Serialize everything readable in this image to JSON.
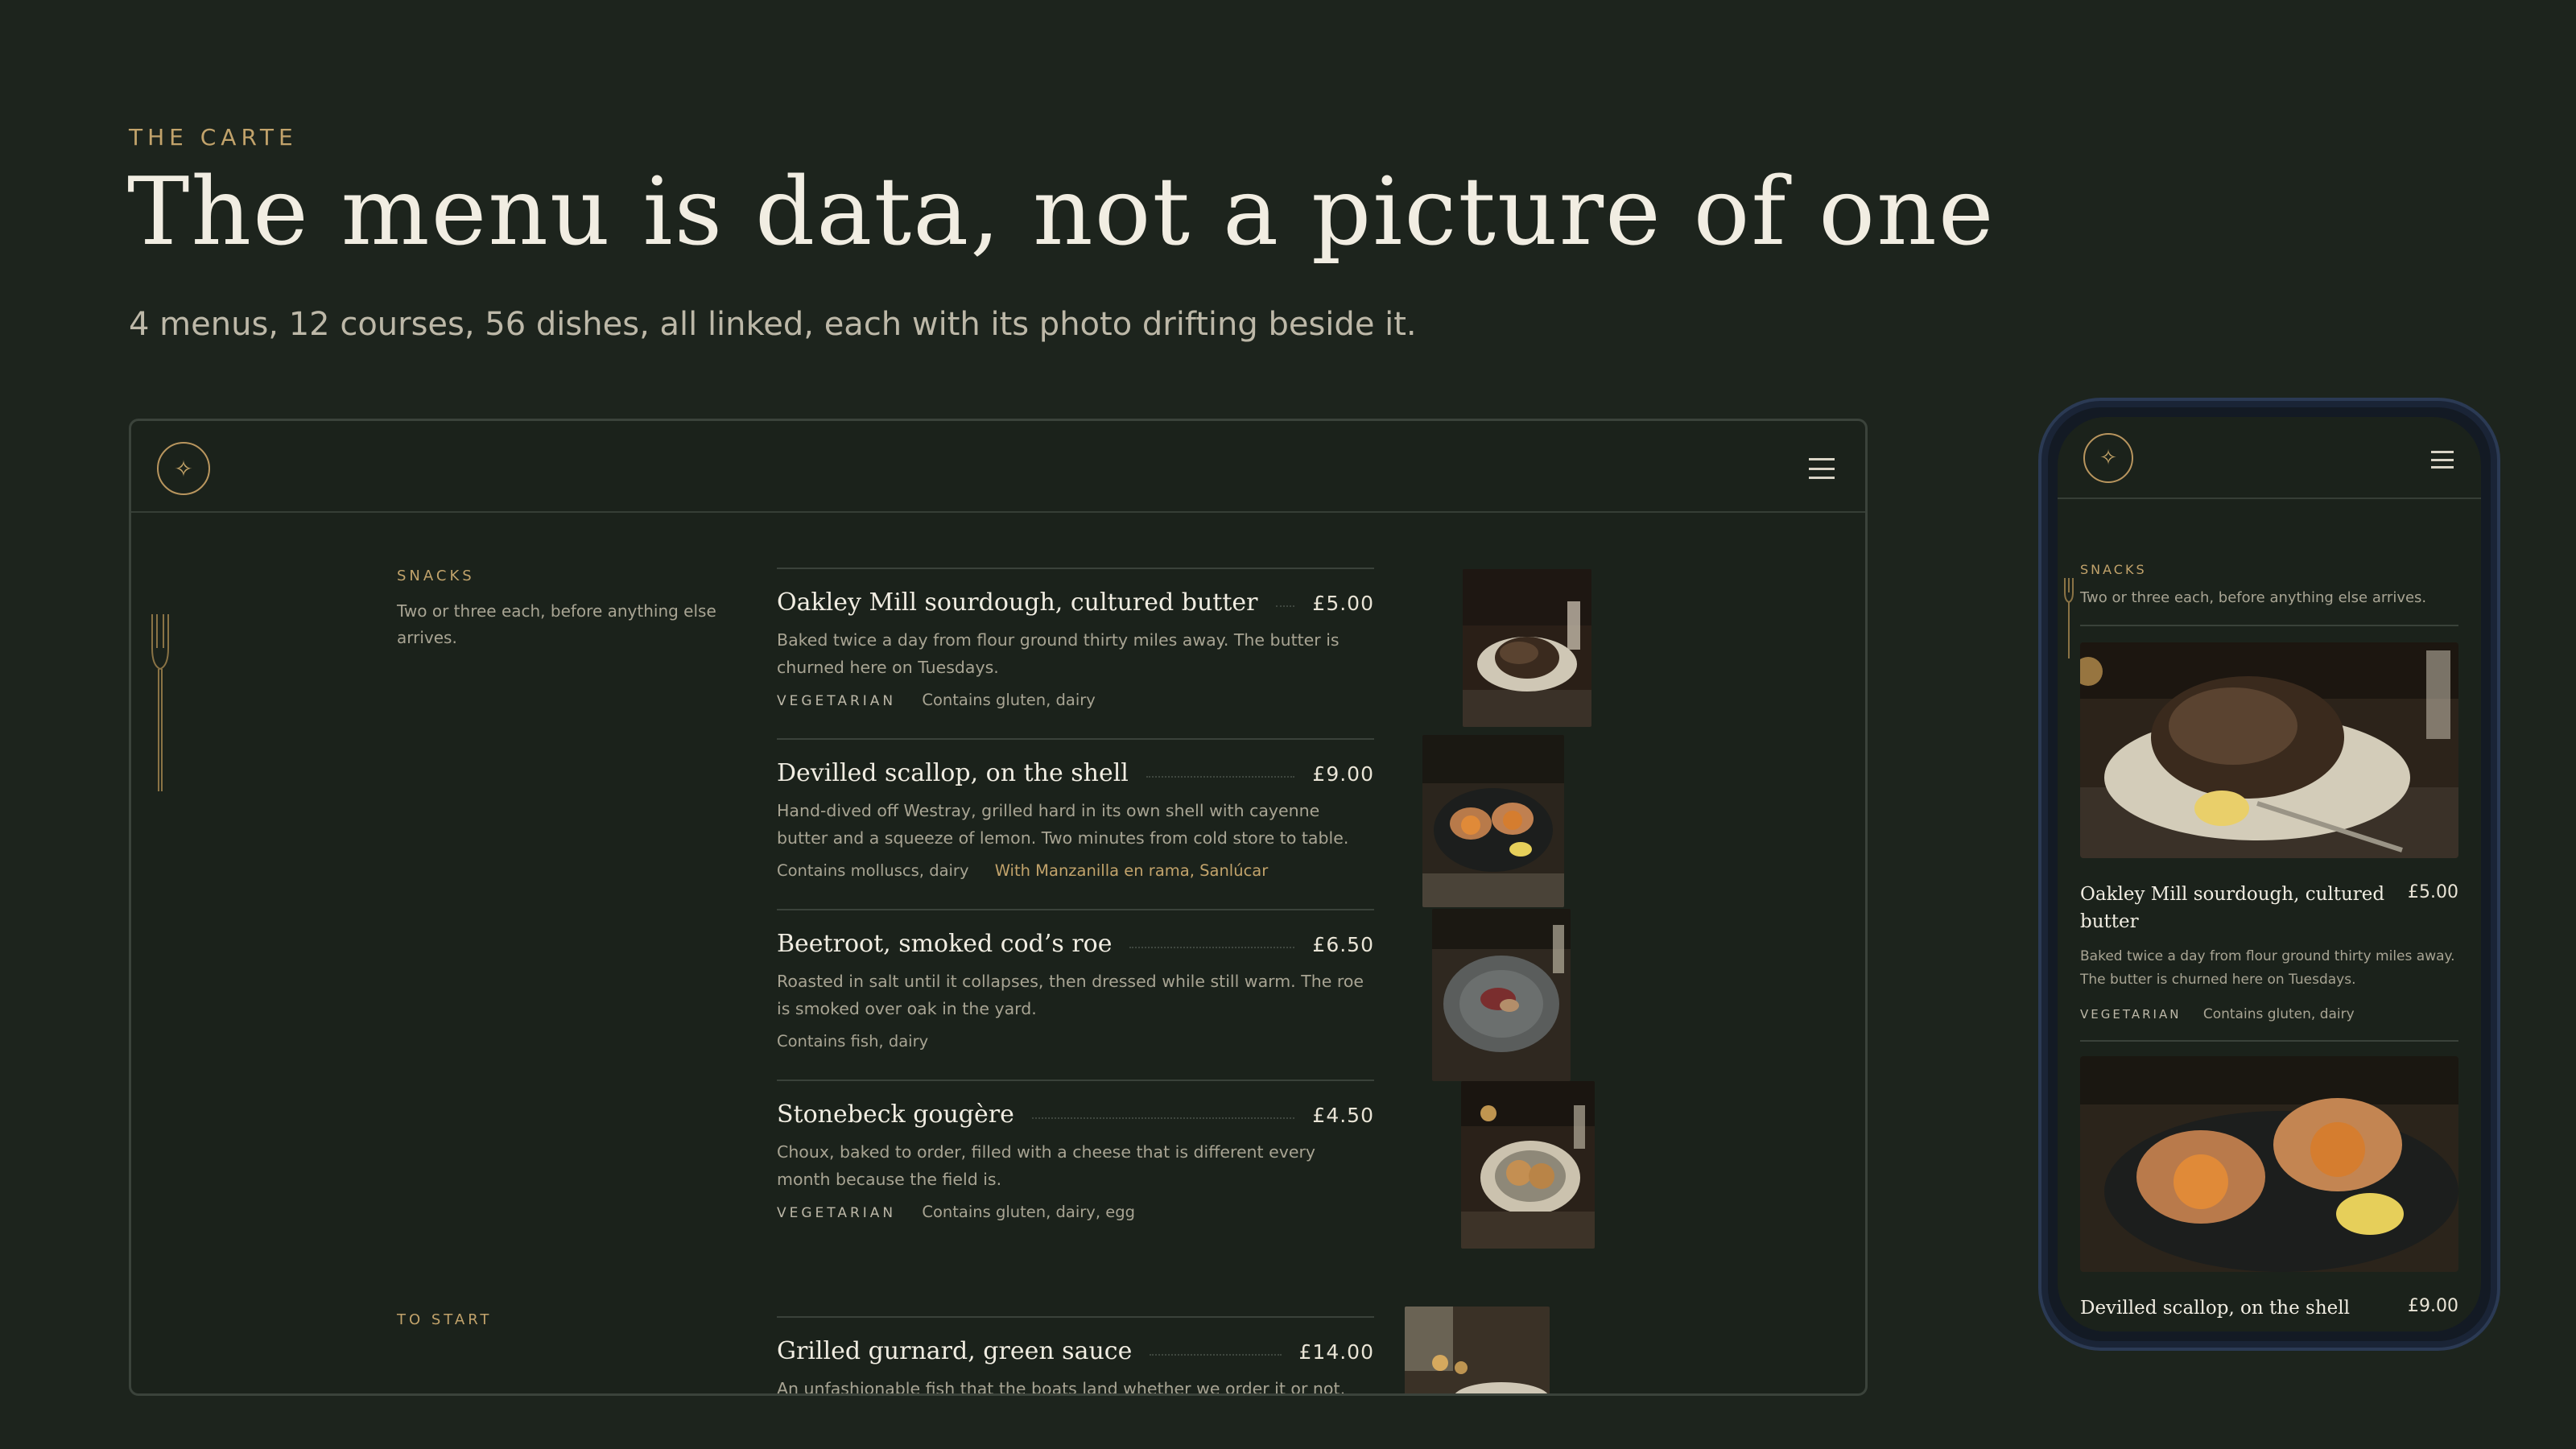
{
  "hero": {
    "eyebrow": "THE CARTE",
    "title": "The menu is data, not a picture of one",
    "subtitle": "4 menus, 12 courses, 56 dishes, all linked, each with its photo drifting beside it."
  },
  "brand": {
    "logo_glyph": "✧"
  },
  "desktop": {
    "courses": [
      {
        "label": "SNACKS",
        "note": "Two or three each, before anything else arrives."
      },
      {
        "label": "TO START",
        "note": ""
      }
    ],
    "dishes": [
      {
        "name": "Oakley Mill sourdough, cultured butter",
        "price": "£5.00",
        "description": "Baked twice a day from flour ground thirty miles away. The butter is churned here on Tuesdays.",
        "tag": "VEGETARIAN",
        "allergens": "Contains gluten, dairy",
        "pairing": ""
      },
      {
        "name": "Devilled scallop, on the shell",
        "price": "£9.00",
        "description": "Hand-dived off Westray, grilled hard in its own shell with cayenne butter and a squeeze of lemon. Two minutes from cold store to table.",
        "tag": "",
        "allergens": "Contains molluscs, dairy",
        "pairing": "With Manzanilla en rama, Sanlúcar"
      },
      {
        "name": "Beetroot, smoked cod’s roe",
        "price": "£6.50",
        "description": "Roasted in salt until it collapses, then dressed while still warm. The roe is smoked over oak in the yard.",
        "tag": "",
        "allergens": "Contains fish, dairy",
        "pairing": ""
      },
      {
        "name": "Stonebeck gougère",
        "price": "£4.50",
        "description": "Choux, baked to order, filled with a cheese that is different every month because the field is.",
        "tag": "VEGETARIAN",
        "allergens": "Contains gluten, dairy, egg",
        "pairing": ""
      },
      {
        "name": "Grilled gurnard, green sauce",
        "price": "£14.00",
        "description": "An unfashionable fish that the boats land whether we order it or not, and",
        "tag": "",
        "allergens": "",
        "pairing": ""
      }
    ]
  },
  "mobile": {
    "course": {
      "label": "SNACKS",
      "note": "Two or three each, before anything else arrives."
    },
    "dishes": [
      {
        "name": "Oakley Mill sourdough, cultured butter",
        "price": "£5.00",
        "description": "Baked twice a day from flour ground thirty miles away. The butter is churned here on Tuesdays.",
        "tag": "VEGETARIAN",
        "allergens": "Contains gluten, dairy"
      },
      {
        "name": "Devilled scallop, on the shell",
        "price": "£9.00"
      }
    ]
  },
  "colors": {
    "background": "#1d241d",
    "panel": "#1b221b",
    "accent_gold": "#c2a36b",
    "text_primary": "#f1ede2",
    "text_muted": "#a8a493",
    "phone_bezel": "#1a2436"
  },
  "icons": [
    "sparkle-logo-icon",
    "hamburger-menu-icon",
    "fork-icon"
  ]
}
